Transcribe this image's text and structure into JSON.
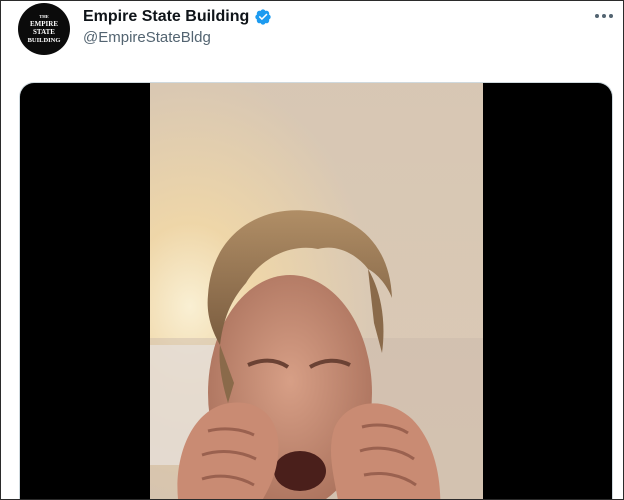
{
  "tweet": {
    "author": {
      "display_name": "Empire State Building",
      "handle": "@EmpireStateBldg",
      "verified": true,
      "avatar_logo_text": [
        "THE",
        "EMPIRE",
        "STATE",
        "BUILDING"
      ]
    },
    "more_icon": "more-horizontal-icon",
    "media": {
      "type": "video",
      "description_icon": "video-player"
    }
  },
  "colors": {
    "name": "#0f1419",
    "handle": "#536471",
    "verified_badge": "#1d9bf0",
    "media_background": "#000000"
  }
}
